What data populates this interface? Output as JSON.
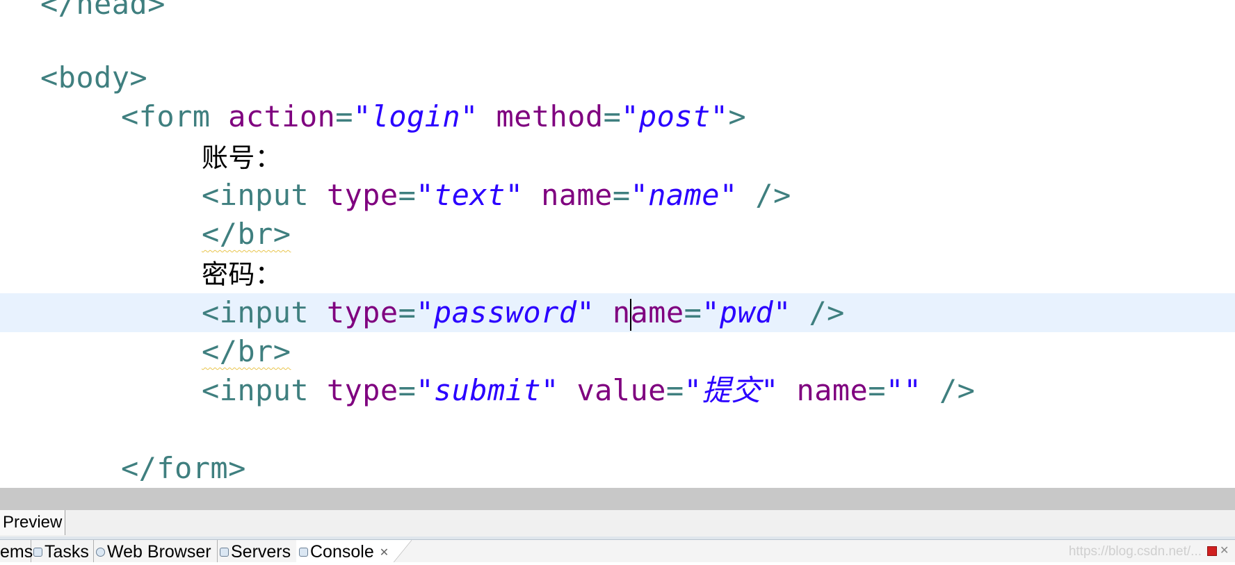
{
  "editor": {
    "lines": [
      [
        {
          "c": "tag",
          "t": "</head>"
        }
      ],
      [],
      [
        {
          "c": "tag",
          "t": "<body>"
        }
      ],
      [
        {
          "c": "tag",
          "t": "<form "
        },
        {
          "c": "attr",
          "t": "action"
        },
        {
          "c": "tag",
          "t": "="
        },
        {
          "c": "val",
          "t": "\"login\""
        },
        {
          "c": "tag",
          "t": " "
        },
        {
          "c": "attr",
          "t": "method"
        },
        {
          "c": "tag",
          "t": "="
        },
        {
          "c": "val",
          "t": "\"post\""
        },
        {
          "c": "tag",
          "t": ">"
        }
      ],
      [
        {
          "c": "text",
          "t": "账号："
        }
      ],
      [
        {
          "c": "tag",
          "t": "<input "
        },
        {
          "c": "attr",
          "t": "type"
        },
        {
          "c": "tag",
          "t": "="
        },
        {
          "c": "val",
          "t": "\"text\""
        },
        {
          "c": "tag",
          "t": " "
        },
        {
          "c": "attr",
          "t": "name"
        },
        {
          "c": "tag",
          "t": "="
        },
        {
          "c": "val",
          "t": "\"name\""
        },
        {
          "c": "tag",
          "t": " />"
        }
      ],
      [
        {
          "c": "tag squiggle",
          "t": "</br>"
        }
      ],
      [
        {
          "c": "text",
          "t": "密码："
        }
      ],
      [
        {
          "c": "tag",
          "t": "<input "
        },
        {
          "c": "attr",
          "t": "type"
        },
        {
          "c": "tag",
          "t": "="
        },
        {
          "c": "val",
          "t": "\"password\""
        },
        {
          "c": "tag",
          "t": " "
        },
        {
          "c": "attr",
          "t": "n"
        },
        {
          "c": "caret",
          "t": ""
        },
        {
          "c": "attr",
          "t": "ame"
        },
        {
          "c": "tag",
          "t": "="
        },
        {
          "c": "val",
          "t": "\"pwd\""
        },
        {
          "c": "tag",
          "t": " />"
        }
      ],
      [
        {
          "c": "tag squiggle",
          "t": "</br>"
        }
      ],
      [
        {
          "c": "tag",
          "t": "<input "
        },
        {
          "c": "attr",
          "t": "type"
        },
        {
          "c": "tag",
          "t": "="
        },
        {
          "c": "val",
          "t": "\"submit\""
        },
        {
          "c": "tag",
          "t": " "
        },
        {
          "c": "attr",
          "t": "value"
        },
        {
          "c": "tag",
          "t": "="
        },
        {
          "c": "val",
          "t": "\"提交\""
        },
        {
          "c": "tag",
          "t": " "
        },
        {
          "c": "attr",
          "t": "name"
        },
        {
          "c": "tag",
          "t": "="
        },
        {
          "c": "val",
          "t": "\"\""
        },
        {
          "c": "tag",
          "t": " />"
        }
      ],
      [],
      [
        {
          "c": "tag",
          "t": "</form>"
        }
      ]
    ]
  },
  "editor_tabs": {
    "preview": "Preview"
  },
  "views": {
    "problems": "ems",
    "tasks": "Tasks",
    "web_browser": "Web Browser",
    "servers": "Servers",
    "console": "Console"
  },
  "watermark": "https://blog.csdn.net/..."
}
